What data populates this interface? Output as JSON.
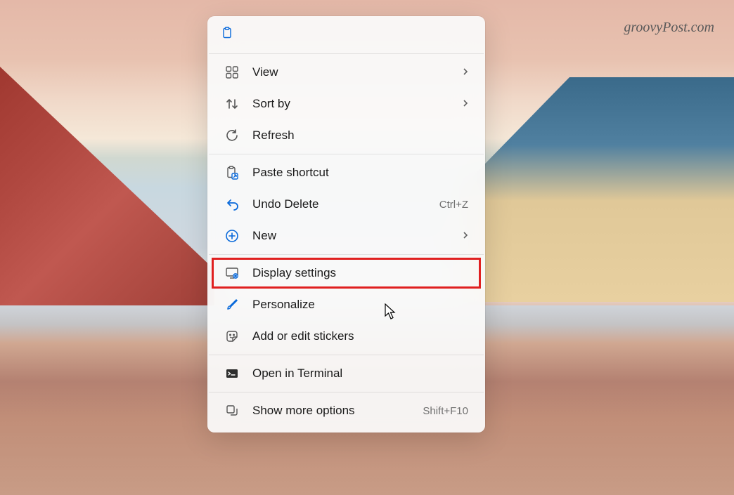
{
  "watermark": "groovyPost.com",
  "menu": {
    "header_icon": "clipboard-icon",
    "sections": [
      [
        {
          "icon": "grid-icon",
          "label": "View",
          "has_submenu": true
        },
        {
          "icon": "sort-icon",
          "label": "Sort by",
          "has_submenu": true
        },
        {
          "icon": "refresh-icon",
          "label": "Refresh"
        }
      ],
      [
        {
          "icon": "paste-shortcut-icon",
          "label": "Paste shortcut"
        },
        {
          "icon": "undo-icon",
          "label": "Undo Delete",
          "shortcut": "Ctrl+Z"
        },
        {
          "icon": "plus-circle-icon",
          "label": "New",
          "has_submenu": true
        }
      ],
      [
        {
          "icon": "display-icon",
          "label": "Display settings",
          "highlighted": true
        },
        {
          "icon": "brush-icon",
          "label": "Personalize"
        },
        {
          "icon": "sticker-icon",
          "label": "Add or edit stickers"
        }
      ],
      [
        {
          "icon": "terminal-icon",
          "label": "Open in Terminal"
        }
      ],
      [
        {
          "icon": "more-options-icon",
          "label": "Show more options",
          "shortcut": "Shift+F10"
        }
      ]
    ]
  }
}
